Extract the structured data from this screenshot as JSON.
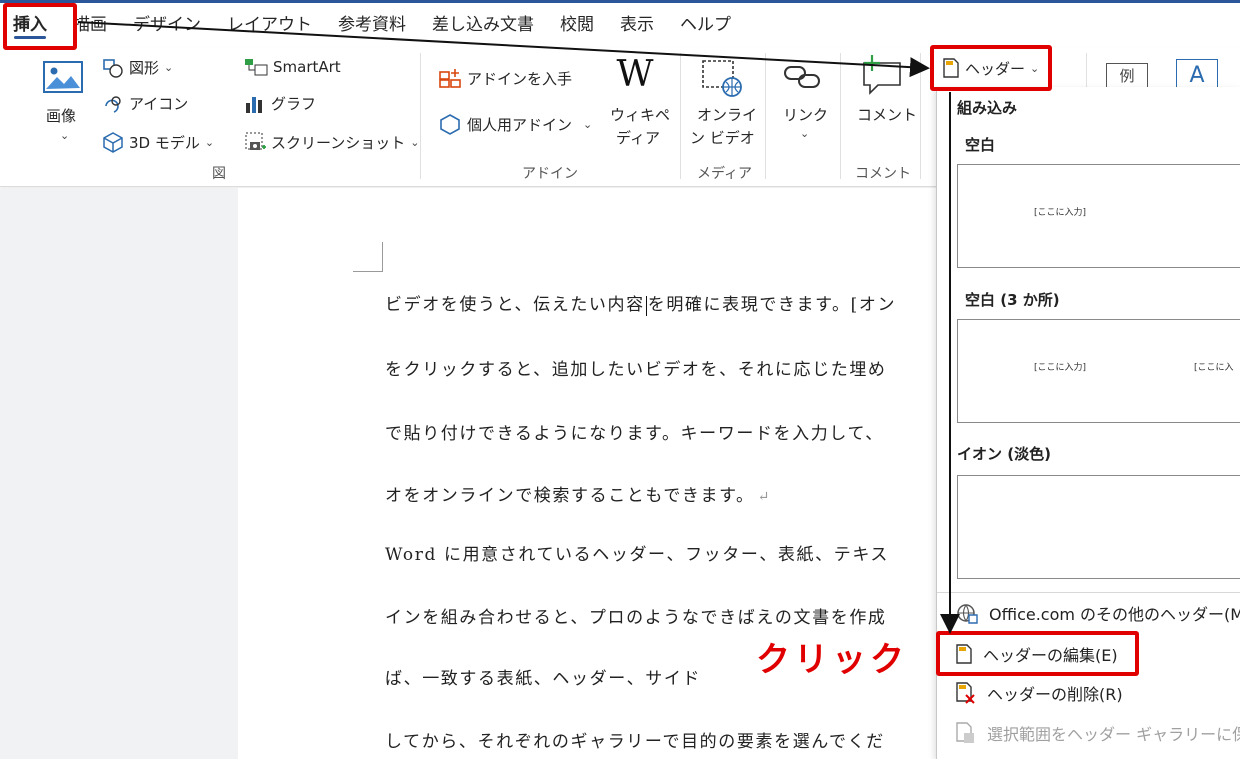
{
  "tabs": [
    "挿入",
    "描画",
    "デザイン",
    "レイアウト",
    "参考資料",
    "差し込み文書",
    "校閲",
    "表示",
    "ヘルプ"
  ],
  "ribbon": {
    "image": "画像",
    "shapes": "図形",
    "icons": "アイコン",
    "models3d": "3D モデル",
    "smartart": "SmartArt",
    "chart": "グラフ",
    "screenshot": "スクリーンショット",
    "group_illust": "図",
    "get_addins": "アドインを入手",
    "my_addins": "個人用アドイン",
    "wiki_icon_text": "W",
    "wikipedia_l1": "ウィキペ",
    "wikipedia_l2": "ディア",
    "group_addins": "アドイン",
    "online_video_l1": "オンライ",
    "online_video_l2": "ン ビデオ",
    "group_media": "メディア",
    "link": "リンク",
    "comment": "コメント",
    "group_comment": "コメント",
    "header_btn": "ヘッダー",
    "ex_text": "例",
    "textbox_letter": "A"
  },
  "document": {
    "lines": [
      "ビデオを使うと、伝えたい内容",
      "を明確に表現できます。[オン",
      "をクリックすると、追加したいビデオを、それに応じた埋め",
      "で貼り付けできるようになります。キーワードを入力して、",
      "オをオンラインで検索することもできます。",
      "Word に用意されているヘッダー、フッター、表紙、テキス",
      "インを組み合わせると、プロのようなできばえの文書を作成",
      "ば、一致する表紙、ヘッダー、サイド",
      "してから、それぞれのギャラリーで目的の要素を選んでくだ"
    ],
    "return_mark": "↵"
  },
  "gallery": {
    "section": "組み込み",
    "cat_blank": "空白",
    "cat_blank3": "空白 (3 か所)",
    "cat_ion": "イオン (淡色)",
    "placeholder": "[ここに入力]",
    "placeholder_cut": "[ここに入",
    "more_headers": "Office.com のその他のヘッダー(M)",
    "edit_header": "ヘッダーの編集(E)",
    "remove_header": "ヘッダーの削除(R)",
    "save_selection": "選択範囲をヘッダー ギャラリーに保存("
  },
  "annotation": {
    "click_label": "クリック",
    "highlight_color": "#e00000"
  }
}
